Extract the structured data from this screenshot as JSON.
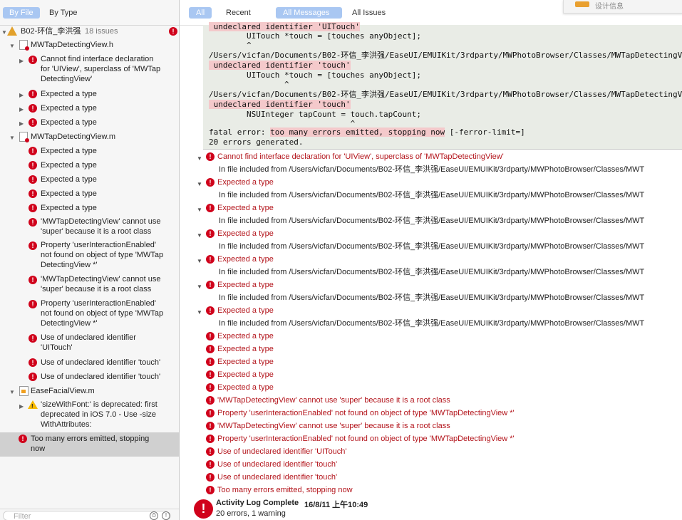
{
  "left_panel": {
    "tabs": [
      "By File",
      "By Type"
    ],
    "project": {
      "name": "B02-环信_李洪强",
      "count": "18 issues"
    },
    "file1": {
      "name": "MWTapDetectingView.h",
      "issues": [
        "Cannot find interface declaration",
        "for 'UIView', superclass of 'MWTap",
        "DetectingView'",
        "Expected a type",
        "Expected a type",
        "Expected a type"
      ]
    },
    "file2": {
      "name": "MWTapDetectingView.m",
      "issues": [
        "Expected a type",
        "Expected a type",
        "Expected a type",
        "Expected a type",
        "Expected a type",
        "'MWTapDetectingView' cannot use",
        "'super' because it is a root class",
        "Property 'userInteractionEnabled'",
        "not found on object of type 'MWTap",
        "DetectingView *'",
        "'MWTapDetectingView' cannot use",
        "'super' because it is a root class",
        "Property 'userInteractionEnabled'",
        "not found on object of type 'MWTap",
        "DetectingView *'",
        "Use of undeclared identifier",
        "'UITouch'",
        "Use of undeclared identifier 'touch'",
        "Use of undeclared identifier 'touch'"
      ]
    },
    "file3": {
      "name": "EaseFacialView.m",
      "warning": [
        "'sizeWithFont:' is deprecated: first",
        "deprecated in iOS 7.0 - Use -size",
        "WithAttributes:"
      ]
    },
    "selected": [
      "Too many errors emitted, stopping",
      "now"
    ],
    "filter_placeholder": "Filter"
  },
  "right_panel": {
    "tabs": [
      "All",
      "Recent",
      "All Messages",
      "All Issues"
    ],
    "notif_text": "设计信息",
    "console": [
      " undeclared identifier 'UITouch'",
      "        UITouch *touch = [touches anyObject];",
      "        ^",
      "/Users/vicfan/Documents/B02-环信_李洪强/EaseUI/EMUIKit/3rdparty/MWPhotoBrowser/Classes/MWTapDetectingVie",
      " undeclared identifier 'touch'",
      "        UITouch *touch = [touches anyObject];",
      "                ^",
      "/Users/vicfan/Documents/B02-环信_李洪强/EaseUI/EMUIKit/3rdparty/MWPhotoBrowser/Classes/MWTapDetectingVie",
      " undeclared identifier 'touch'",
      "        NSUInteger tapCount = touch.tapCount;",
      "                              ^",
      "fatal error: ",
      "too many errors emitted, stopping now",
      " [-ferror-limit=]",
      "20 errors generated."
    ],
    "messages": [
      "Cannot find interface declaration for 'UIView', superclass of 'MWTapDetectingView'",
      "Expected a type",
      "Expected a type",
      "Expected a type",
      "Expected a type",
      "Expected a type",
      "Expected a type",
      "Expected a type",
      "Expected a type",
      "Expected a type",
      "Expected a type",
      "Expected a type",
      "'MWTapDetectingView' cannot use 'super' because it is a root class",
      "Property 'userInteractionEnabled' not found on object of type 'MWTapDetectingView *'",
      "'MWTapDetectingView' cannot use 'super' because it is a root class",
      "Property 'userInteractionEnabled' not found on object of type 'MWTapDetectingView *'",
      "Use of undeclared identifier 'UITouch'",
      "Use of undeclared identifier 'touch'",
      "Use of undeclared identifier 'touch'",
      "Too many errors emitted, stopping now"
    ],
    "included_from": "In file included from /Users/vicfan/Documents/B02-环信_李洪强/EaseUI/EMUIKit/3rdparty/MWPhotoBrowser/Classes/MWT",
    "summary": {
      "title": "Activity Log Complete",
      "time": "16/8/11 上午10:49",
      "detail": "20 errors, 1 warning"
    }
  },
  "colors": {
    "error": "#d0021b",
    "warning": "#f5b800",
    "selected_tab": "#a9c7f2",
    "console_bg": "#e9ece6",
    "highlight": "#f4c9cb"
  }
}
